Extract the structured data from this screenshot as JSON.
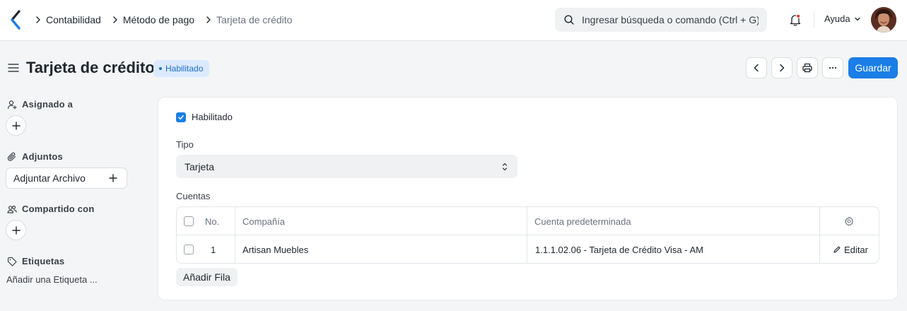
{
  "navbar": {
    "breadcrumbs": [
      "Contabilidad",
      "Método de pago",
      "Tarjeta de crédito"
    ],
    "search_placeholder": "Ingresar búsqueda o comando (Ctrl + G)",
    "help_label": "Ayuda"
  },
  "page": {
    "title": "Tarjeta de crédito",
    "status": "Habilitado",
    "save_label": "Guardar"
  },
  "sidebar": {
    "assigned_label": "Asignado a",
    "attachments_label": "Adjuntos",
    "attach_button": "Adjuntar Archivo",
    "shared_label": "Compartido con",
    "tags_label": "Etiquetas",
    "add_tag": "Añadir una Etiqueta ..."
  },
  "form": {
    "enabled_label": "Habilitado",
    "enabled": true,
    "type_label": "Tipo",
    "type_value": "Tarjeta",
    "accounts_label": "Cuentas",
    "table": {
      "headers": {
        "no": "No.",
        "company": "Compañía",
        "account": "Cuenta predeterminada"
      },
      "rows": [
        {
          "no": "1",
          "company": "Artisan Muebles",
          "account": "1.1.1.02.06 - Tarjeta de Crédito Visa - AM",
          "edit": "Editar"
        }
      ]
    },
    "add_row": "Añadir Fila"
  },
  "colors": {
    "primary": "#1a7ee6",
    "badge_bg": "#dbeafe",
    "badge_text": "#1d6fc4",
    "notification": "#e03636"
  }
}
